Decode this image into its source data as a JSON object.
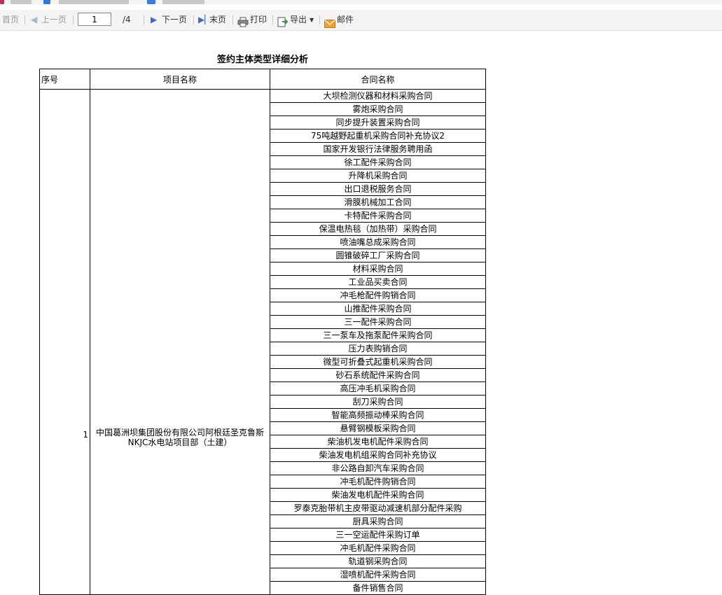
{
  "toolbar": {
    "first_label": "首页",
    "prev_label": "上一页",
    "page_value": "1",
    "page_total": "/4",
    "next_label": "下一页",
    "last_label": "末页",
    "print_label": "打印",
    "export_label": "导出",
    "mail_label": "邮件"
  },
  "report": {
    "title": "签约主体类型详细分析",
    "headers": {
      "seq": "序号",
      "project": "项目名称",
      "contract": "合同名称"
    },
    "row": {
      "seq": "1",
      "project": "中国葛洲坝集团股份有限公司阿根廷圣克鲁斯NKJC水电站项目部（土建）"
    },
    "contracts": [
      "大坝检测仪器和材料采购合同",
      "雾炮采购合同",
      "同步提升装置采购合同",
      "75吨越野起重机采购合同补充协议2",
      "国家开发银行法律服务聘用函",
      "徐工配件采购合同",
      "升降机采购合同",
      "出口退税服务合同",
      "滑膜机械加工合同",
      "卡特配件采购合同",
      "保温电热毯（加热带）采购合同",
      "喷油嘴总成采购合同",
      "圆锥破碎工厂采购合同",
      "材料采购合同",
      "工业品买卖合同",
      "冲毛枪配件购销合同",
      "山推配件采购合同",
      "三一配件采购合同",
      "三一泵车及拖泵配件采购合同",
      "压力表购销合同",
      "微型可折叠式起重机采购合同",
      "砂石系统配件采购合同",
      "高压冲毛机采购合同",
      "刮刀采购合同",
      "智能高频振动棒采购合同",
      "悬臂钢模板采购合同",
      "柴油机发电机配件采购合同",
      "柴油发电机组采购合同补充协议",
      "非公路自卸汽车采购合同",
      "冲毛机配件购销合同",
      "柴油发电机配件采购合同",
      "罗泰克胎带机主皮带驱动减速机部分配件采购",
      "厨具采购合同",
      "三一空运配件采购订单",
      "冲毛机配件采购合同",
      "轨道钢采购合同",
      "湿喷机配件采购合同",
      "备件销售合同"
    ]
  },
  "colors": {
    "toolbar_bg": "#f4f4f4",
    "arrow_blue": "#3a6fc0",
    "mail_orange": "#f0a030",
    "export_green": "#3b9a3b"
  },
  "icons": {
    "prev": "triangle-left",
    "next": "triangle-right",
    "last": "skip-end",
    "print": "printer",
    "export": "export-doc",
    "mail": "envelope",
    "dropdown": "caret-down"
  }
}
